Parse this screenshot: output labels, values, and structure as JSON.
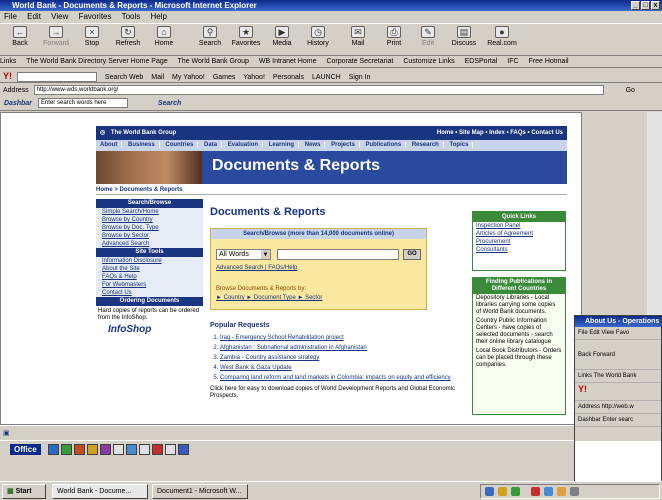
{
  "window": {
    "title": "World Bank - Documents & Reports - Microsoft Internet Explorer",
    "controls": [
      "_",
      "□",
      "x"
    ]
  },
  "menu": [
    "File",
    "Edit",
    "View",
    "Favorites",
    "Tools",
    "Help"
  ],
  "toolbar": [
    "Back",
    "Forward",
    "Stop",
    "Refresh",
    "Home",
    "Search",
    "Favorites",
    "Media",
    "History",
    "Mail",
    "Print",
    "Edit",
    "Discuss",
    "Real.com"
  ],
  "links": {
    "label": "Links",
    "items": [
      "The World Bank Directory Server Home Page",
      "The World Bank Group",
      "WB Intranet Home",
      "Corporate Secretariat",
      "Customize Links",
      "EDSPortal",
      "IFC",
      "Free Hotmail"
    ]
  },
  "yahoo": {
    "search_web": "Search Web",
    "items": [
      "Mail",
      "My Yahoo!",
      "Games",
      "Yahoo!",
      "Personals",
      "LAUNCH",
      "Sign In"
    ]
  },
  "address": {
    "label": "Address",
    "url": "http://www-wds.worldbank.org/",
    "go": "Go"
  },
  "dashbar": {
    "label": "Dashbar",
    "placeholder": "Enter search words here",
    "search": "Search"
  },
  "site": {
    "org": "The World Bank Group",
    "toplinks": "Home • Site Map • Index • FAQs • Contact Us",
    "nav": [
      "About",
      "Business",
      "Countries",
      "Data",
      "Evaluation",
      "Learning",
      "News",
      "Projects",
      "Publications",
      "Research",
      "Topics"
    ],
    "banner": "Documents & Reports",
    "crumb": "Home > Documents & Reports",
    "heading": "Documents & Reports",
    "leftnav": {
      "search_hdr": "Search/Browse",
      "search_items": [
        "Simple Search/Home",
        "Browse by Country",
        "Browse by Doc. Type",
        "Browse by Sector",
        "Advanced Search"
      ],
      "tools_hdr": "Site Tools",
      "tools_items": [
        "Information Disclosure",
        "About the Site",
        "FAQs & Help",
        "For Webmasters",
        "Contact Us"
      ],
      "order_hdr": "Ordering Documents",
      "order_text": "Hard copies of reports can be ordered from the InfoShop.",
      "infoshop": "InfoShop"
    },
    "searchbox": {
      "header": "Search/Browse (more than 14,000 documents online)",
      "select": "All Words",
      "go": "GO",
      "links": "Advanced Search | FAQs/Help",
      "browse_label": "Browse Documents & Reports by:",
      "browse_links": "► Country  ► Document Type  ► Sector"
    },
    "popular": {
      "heading": "Popular Requests",
      "items": [
        "Iraq - Emergency School Rehabilitation project",
        "Afghanistan : Subnational administration in Afghanistan",
        "Zambia - Country assistance strategy",
        "West Bank & Gaza Update",
        "Comparing land reform and land markets in Colombia: impacts on equity and efficiency"
      ],
      "footer": "Click here for easy to download copies of World Development Reports and Global Economic Prospects."
    },
    "quick": {
      "header": "Quick Links",
      "items": [
        "Inspection Panel",
        "Articles of Agreement",
        "Procurement",
        "Consultants"
      ]
    },
    "finding": {
      "header": "Finding Publications in Different Countries",
      "items": [
        "Depository Libraries - Local libraries carrying some copies of World Bank documents.",
        "Country Public Information Centers - have copies of selected documents - search their online library catalogue",
        "Local Book Distributors - Orders can be placed through these companies."
      ]
    }
  },
  "about_window": {
    "title": "About Us - Operations",
    "menu": "File  Edit  View  Favo",
    "toolbar": "Back    Forward",
    "links": "Links  The World Bank",
    "address": "Address  http://web.w",
    "dash": "Dashbar  Enter searc"
  },
  "office": {
    "label": "Office"
  },
  "taskbar": {
    "start": "Start",
    "buttons": [
      "World Bank - Docume...",
      "Document1 - Microsoft W..."
    ]
  }
}
